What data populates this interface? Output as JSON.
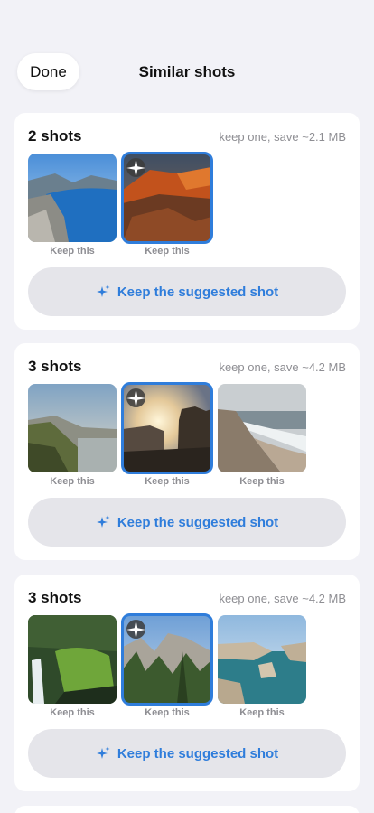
{
  "header": {
    "done_label": "Done",
    "title": "Similar shots"
  },
  "groups": [
    {
      "count": "2 shots",
      "save": "keep one, save ~2.1 MB",
      "thumbs": [
        {
          "keep": "Keep this",
          "icon": "fjord-photo"
        },
        {
          "keep": "Keep this",
          "icon": "red-canyon-photo",
          "suggested": true
        }
      ],
      "action": "Keep the suggested shot"
    },
    {
      "count": "3 shots",
      "save": "keep one, save ~4.2 MB",
      "thumbs": [
        {
          "keep": "Keep this",
          "icon": "coast-hills-photo"
        },
        {
          "keep": "Keep this",
          "icon": "sunset-cliffs-photo",
          "suggested": true
        },
        {
          "keep": "Keep this",
          "icon": "beach-waves-photo"
        }
      ],
      "action": "Keep the suggested shot"
    },
    {
      "count": "3 shots",
      "save": "keep one, save ~4.2 MB",
      "thumbs": [
        {
          "keep": "Keep this",
          "icon": "waterfall-photo"
        },
        {
          "keep": "Keep this",
          "icon": "yosemite-valley-photo",
          "suggested": true
        },
        {
          "keep": "Keep this",
          "icon": "sea-stacks-photo"
        }
      ],
      "action": "Keep the suggested shot"
    }
  ],
  "colors": {
    "accent": "#2F7DDB",
    "background": "#F2F2F7",
    "button_bg": "#E5E5EA"
  }
}
